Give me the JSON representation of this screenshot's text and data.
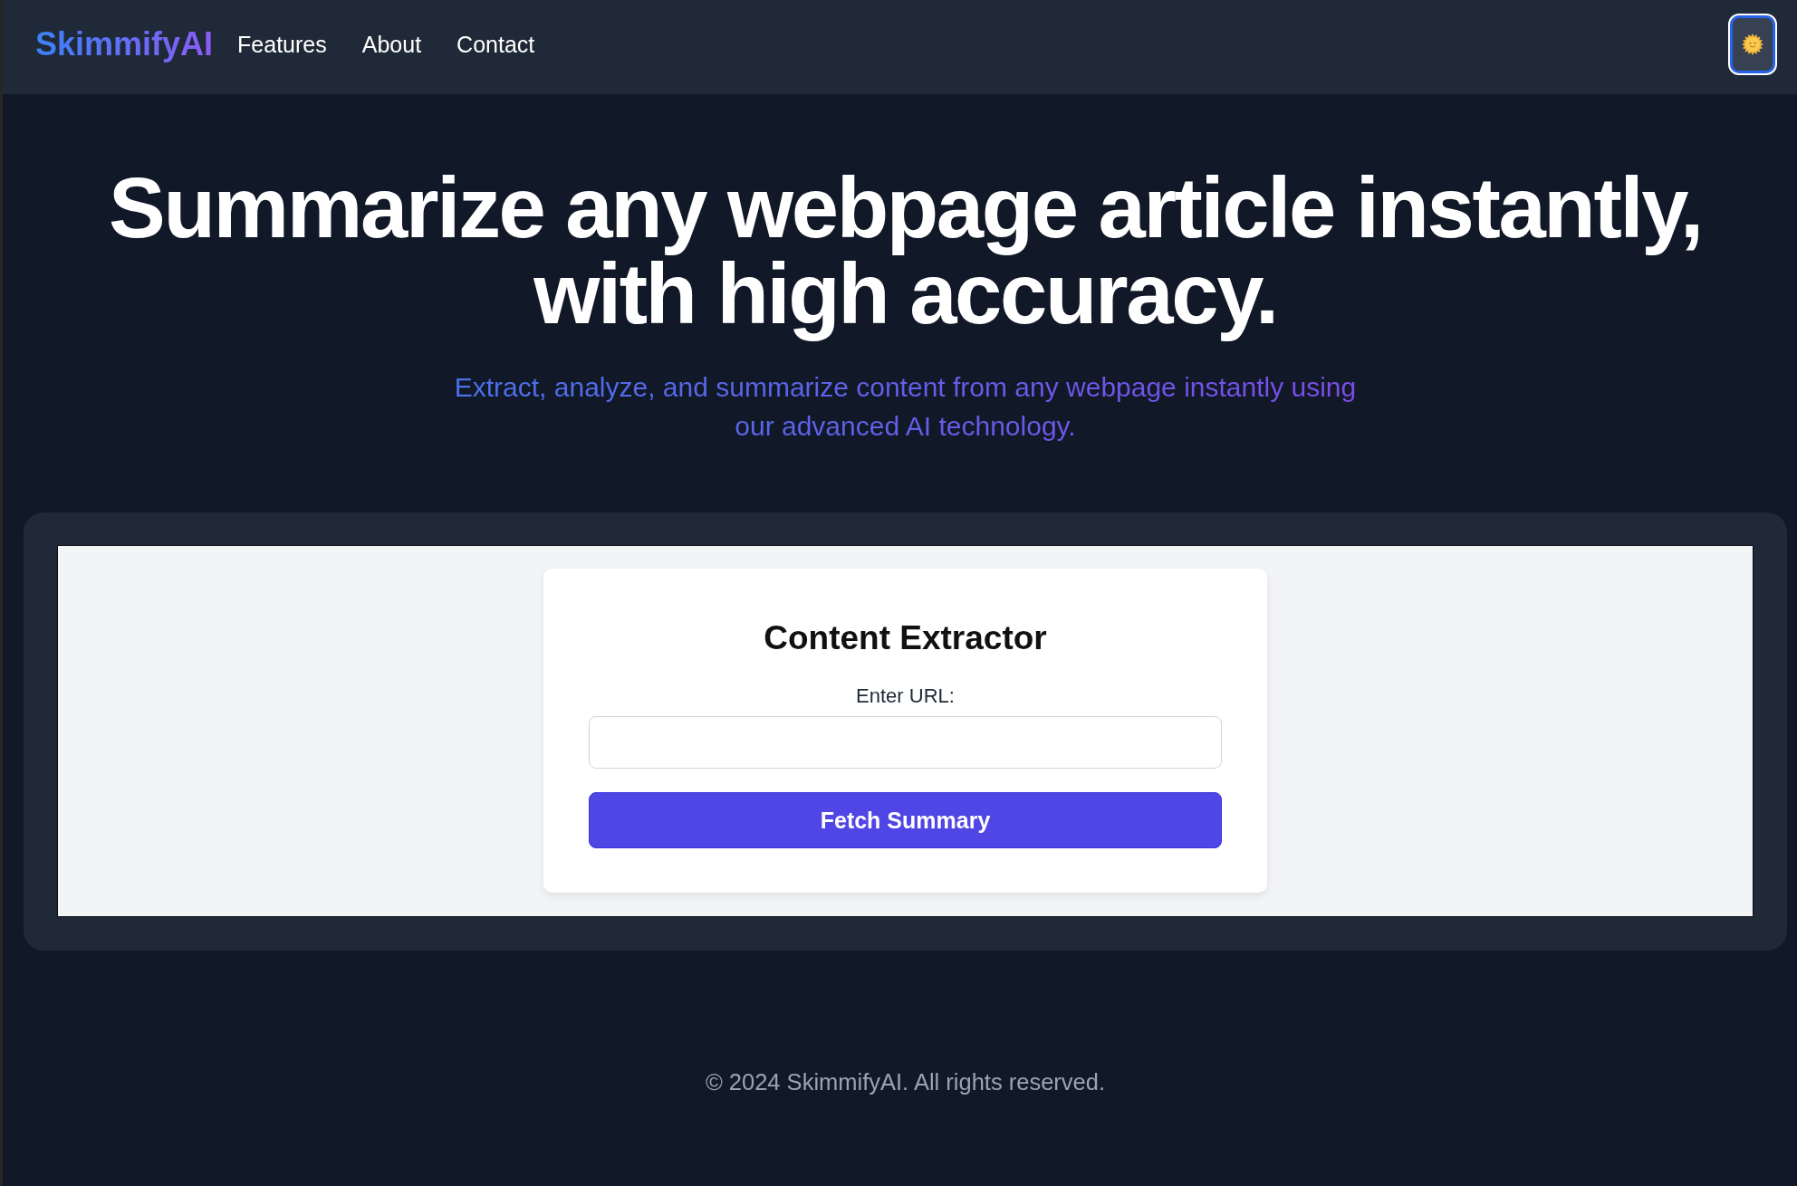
{
  "navbar": {
    "logo": "SkimmifyAI",
    "links": [
      "Features",
      "About",
      "Contact"
    ],
    "theme_button": {
      "focused": true
    }
  },
  "hero": {
    "title": "Summarize any webpage article instantly, with high accuracy.",
    "subtitle": "Extract, analyze, and summarize content from any webpage instantly using our advanced AI technology."
  },
  "extractor": {
    "title": "Content Extractor",
    "url_label": "Enter URL:",
    "submit_button": "Fetch Summary"
  },
  "footer": {
    "copyright": "© 2024 SkimmifyAI. All rights reserved."
  }
}
